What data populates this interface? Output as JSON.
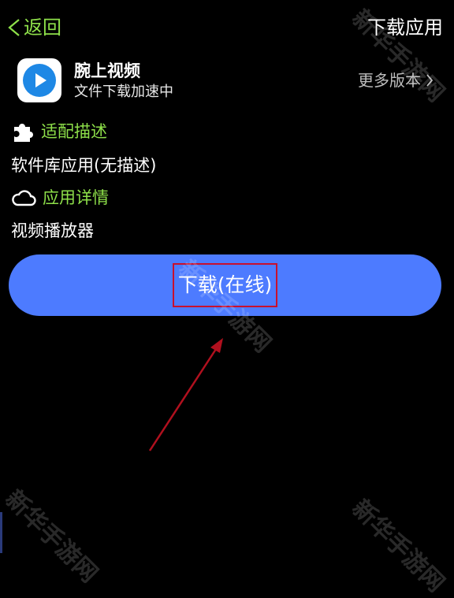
{
  "header": {
    "back_label": "返回",
    "title": "下载应用"
  },
  "app": {
    "name": "腕上视频",
    "status": "文件下载加速中",
    "more_versions": "更多版本",
    "icon": "play-icon"
  },
  "sections": [
    {
      "icon": "puzzle-icon",
      "heading": "适配描述",
      "text": "软件库应用(无描述)"
    },
    {
      "icon": "cloud-icon",
      "heading": "应用详情",
      "text": "视频播放器"
    }
  ],
  "download_button": {
    "label": "下载(在线)",
    "color": "#4d7bff"
  },
  "annotation": {
    "highlight_color": "#c8102e",
    "arrow_color": "#b0101e"
  },
  "watermark": "新华手游网",
  "colors": {
    "accent": "#8ee04a",
    "background": "#000000"
  }
}
